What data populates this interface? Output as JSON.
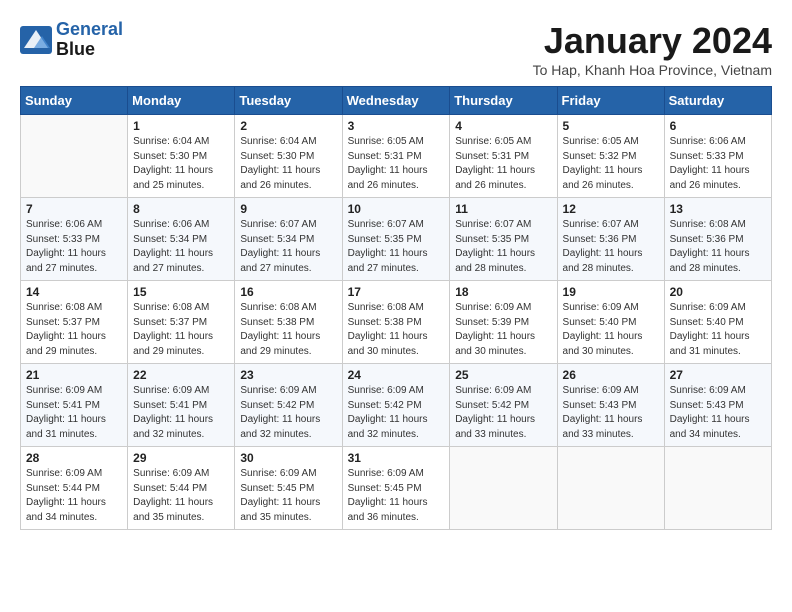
{
  "header": {
    "logo_general": "General",
    "logo_blue": "Blue",
    "month_title": "January 2024",
    "subtitle": "To Hap, Khanh Hoa Province, Vietnam"
  },
  "weekdays": [
    "Sunday",
    "Monday",
    "Tuesday",
    "Wednesday",
    "Thursday",
    "Friday",
    "Saturday"
  ],
  "weeks": [
    [
      {
        "day": "",
        "info": ""
      },
      {
        "day": "1",
        "info": "Sunrise: 6:04 AM\nSunset: 5:30 PM\nDaylight: 11 hours\nand 25 minutes."
      },
      {
        "day": "2",
        "info": "Sunrise: 6:04 AM\nSunset: 5:30 PM\nDaylight: 11 hours\nand 26 minutes."
      },
      {
        "day": "3",
        "info": "Sunrise: 6:05 AM\nSunset: 5:31 PM\nDaylight: 11 hours\nand 26 minutes."
      },
      {
        "day": "4",
        "info": "Sunrise: 6:05 AM\nSunset: 5:31 PM\nDaylight: 11 hours\nand 26 minutes."
      },
      {
        "day": "5",
        "info": "Sunrise: 6:05 AM\nSunset: 5:32 PM\nDaylight: 11 hours\nand 26 minutes."
      },
      {
        "day": "6",
        "info": "Sunrise: 6:06 AM\nSunset: 5:33 PM\nDaylight: 11 hours\nand 26 minutes."
      }
    ],
    [
      {
        "day": "7",
        "info": "Sunrise: 6:06 AM\nSunset: 5:33 PM\nDaylight: 11 hours\nand 27 minutes."
      },
      {
        "day": "8",
        "info": "Sunrise: 6:06 AM\nSunset: 5:34 PM\nDaylight: 11 hours\nand 27 minutes."
      },
      {
        "day": "9",
        "info": "Sunrise: 6:07 AM\nSunset: 5:34 PM\nDaylight: 11 hours\nand 27 minutes."
      },
      {
        "day": "10",
        "info": "Sunrise: 6:07 AM\nSunset: 5:35 PM\nDaylight: 11 hours\nand 27 minutes."
      },
      {
        "day": "11",
        "info": "Sunrise: 6:07 AM\nSunset: 5:35 PM\nDaylight: 11 hours\nand 28 minutes."
      },
      {
        "day": "12",
        "info": "Sunrise: 6:07 AM\nSunset: 5:36 PM\nDaylight: 11 hours\nand 28 minutes."
      },
      {
        "day": "13",
        "info": "Sunrise: 6:08 AM\nSunset: 5:36 PM\nDaylight: 11 hours\nand 28 minutes."
      }
    ],
    [
      {
        "day": "14",
        "info": "Sunrise: 6:08 AM\nSunset: 5:37 PM\nDaylight: 11 hours\nand 29 minutes."
      },
      {
        "day": "15",
        "info": "Sunrise: 6:08 AM\nSunset: 5:37 PM\nDaylight: 11 hours\nand 29 minutes."
      },
      {
        "day": "16",
        "info": "Sunrise: 6:08 AM\nSunset: 5:38 PM\nDaylight: 11 hours\nand 29 minutes."
      },
      {
        "day": "17",
        "info": "Sunrise: 6:08 AM\nSunset: 5:38 PM\nDaylight: 11 hours\nand 30 minutes."
      },
      {
        "day": "18",
        "info": "Sunrise: 6:09 AM\nSunset: 5:39 PM\nDaylight: 11 hours\nand 30 minutes."
      },
      {
        "day": "19",
        "info": "Sunrise: 6:09 AM\nSunset: 5:40 PM\nDaylight: 11 hours\nand 30 minutes."
      },
      {
        "day": "20",
        "info": "Sunrise: 6:09 AM\nSunset: 5:40 PM\nDaylight: 11 hours\nand 31 minutes."
      }
    ],
    [
      {
        "day": "21",
        "info": "Sunrise: 6:09 AM\nSunset: 5:41 PM\nDaylight: 11 hours\nand 31 minutes."
      },
      {
        "day": "22",
        "info": "Sunrise: 6:09 AM\nSunset: 5:41 PM\nDaylight: 11 hours\nand 32 minutes."
      },
      {
        "day": "23",
        "info": "Sunrise: 6:09 AM\nSunset: 5:42 PM\nDaylight: 11 hours\nand 32 minutes."
      },
      {
        "day": "24",
        "info": "Sunrise: 6:09 AM\nSunset: 5:42 PM\nDaylight: 11 hours\nand 32 minutes."
      },
      {
        "day": "25",
        "info": "Sunrise: 6:09 AM\nSunset: 5:42 PM\nDaylight: 11 hours\nand 33 minutes."
      },
      {
        "day": "26",
        "info": "Sunrise: 6:09 AM\nSunset: 5:43 PM\nDaylight: 11 hours\nand 33 minutes."
      },
      {
        "day": "27",
        "info": "Sunrise: 6:09 AM\nSunset: 5:43 PM\nDaylight: 11 hours\nand 34 minutes."
      }
    ],
    [
      {
        "day": "28",
        "info": "Sunrise: 6:09 AM\nSunset: 5:44 PM\nDaylight: 11 hours\nand 34 minutes."
      },
      {
        "day": "29",
        "info": "Sunrise: 6:09 AM\nSunset: 5:44 PM\nDaylight: 11 hours\nand 35 minutes."
      },
      {
        "day": "30",
        "info": "Sunrise: 6:09 AM\nSunset: 5:45 PM\nDaylight: 11 hours\nand 35 minutes."
      },
      {
        "day": "31",
        "info": "Sunrise: 6:09 AM\nSunset: 5:45 PM\nDaylight: 11 hours\nand 36 minutes."
      },
      {
        "day": "",
        "info": ""
      },
      {
        "day": "",
        "info": ""
      },
      {
        "day": "",
        "info": ""
      }
    ]
  ]
}
